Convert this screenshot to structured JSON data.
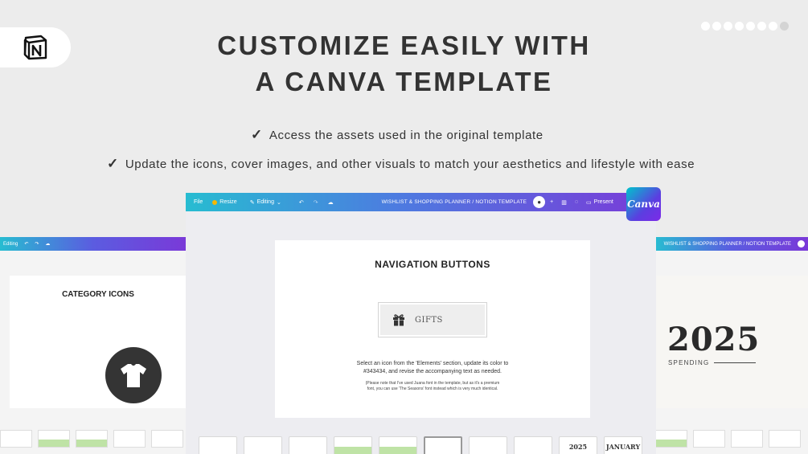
{
  "header": {
    "line1": "CUSTOMIZE EASILY WITH",
    "line2": "A CANVA TEMPLATE"
  },
  "bullets": [
    "Access the assets used in the original template",
    "Update the icons, cover images, and other visuals to match your aesthetics and lifestyle with ease"
  ],
  "carousel": {
    "total": 8,
    "active": 8
  },
  "editor": {
    "toolbar": {
      "file": "File",
      "resize": "Resize",
      "editing": "Editing",
      "doc_title": "WISHLIST & SHOPPING PLANNER  / NOTION TEMPLATE",
      "present": "Present"
    },
    "canvas": {
      "title": "NAVIGATION BUTTONS",
      "button_label": "GIFTS",
      "instruction_1": "Select an icon from the 'Elements' section, update its color to",
      "instruction_2": "#343434, and revise the accompanying text as needed.",
      "note_1": "(Please note that I've used Juana font in the template, but as it's a premium",
      "note_2": "font, you can use 'The Seasons' font instead which is very much identical."
    },
    "pages": [
      {
        "label": "",
        "kind": "plain"
      },
      {
        "label": "",
        "kind": "plain"
      },
      {
        "label": "",
        "kind": "plain"
      },
      {
        "label": "",
        "kind": "land"
      },
      {
        "label": "",
        "kind": "land"
      },
      {
        "label": "",
        "kind": "selected"
      },
      {
        "label": "",
        "kind": "plain"
      },
      {
        "label": "",
        "kind": "plain"
      },
      {
        "label": "2025",
        "kind": "year"
      },
      {
        "label": "JANUARY",
        "kind": "year"
      }
    ]
  },
  "left_shot": {
    "title": "CATEGORY ICONS",
    "editing": "Editing"
  },
  "right_shot": {
    "doc_title": "WISHLIST & SHOPPING PLANNER  / NOTION TEMPLATE",
    "year": "2025",
    "label": "SPENDING"
  },
  "canva_badge": "Canva",
  "colors": {
    "icon_fill": "#343434",
    "toolbar_start": "#27bcd1",
    "toolbar_end": "#7a3ad8"
  }
}
